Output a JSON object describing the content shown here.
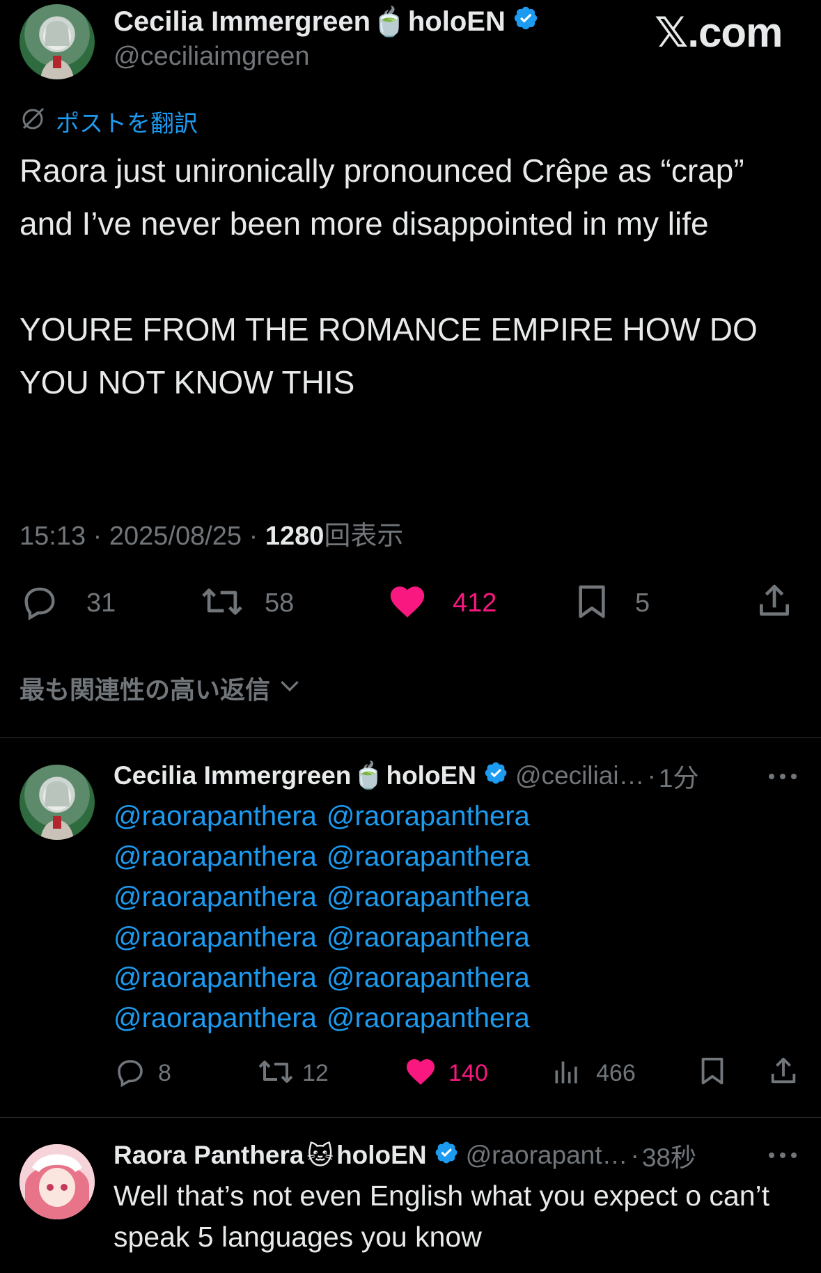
{
  "watermark": "𝕏.com",
  "main_post": {
    "author_name": "Cecilia Immergreen",
    "author_emoji": "🍵",
    "author_suffix": "holoEN",
    "handle": "@ceciliaimgreen",
    "translate_label": "ポストを翻訳",
    "text_p1": "Raora just unironically pronounced Crêpe as “crap” and I’ve never been more disappointed in my life",
    "text_p2": "YOURE FROM THE ROMANCE EMPIRE HOW DO YOU NOT KNOW THIS",
    "time": "15:13",
    "sep1": "·",
    "date": "2025/08/25",
    "sep2": "·",
    "views_count": "1280",
    "views_label": "回表示",
    "metrics": {
      "replies": "31",
      "reposts": "58",
      "likes": "412",
      "bookmarks": "5"
    }
  },
  "sort": {
    "label": "最も関連性の高い返信"
  },
  "replies": [
    {
      "author_name": "Cecilia Immergreen",
      "author_emoji": "🍵",
      "author_suffix": "holoEN",
      "handle": "@ceciliai…",
      "sep": "·",
      "time": "1分",
      "mentions": [
        [
          "@raorapanthera",
          "@raorapanthera"
        ],
        [
          "@raorapanthera",
          "@raorapanthera"
        ],
        [
          "@raorapanthera",
          "@raorapanthera"
        ],
        [
          "@raorapanthera",
          "@raorapanthera"
        ],
        [
          "@raorapanthera",
          "@raorapanthera"
        ],
        [
          "@raorapanthera",
          "@raorapanthera"
        ]
      ],
      "metrics": {
        "replies": "8",
        "reposts": "12",
        "likes": "140",
        "views": "466"
      }
    },
    {
      "author_name": "Raora Panthera",
      "author_emoji": "🐱",
      "author_suffix": "holoEN",
      "handle": "@raorapant…",
      "sep": "·",
      "time": "38秒",
      "text": "Well that’s not even English what you expect o can’t speak 5 languages you know"
    }
  ],
  "colors": {
    "like": "#f91880",
    "link": "#1d9bf0",
    "muted": "#71767b",
    "text": "#e7e9ea",
    "background": "#000000"
  }
}
